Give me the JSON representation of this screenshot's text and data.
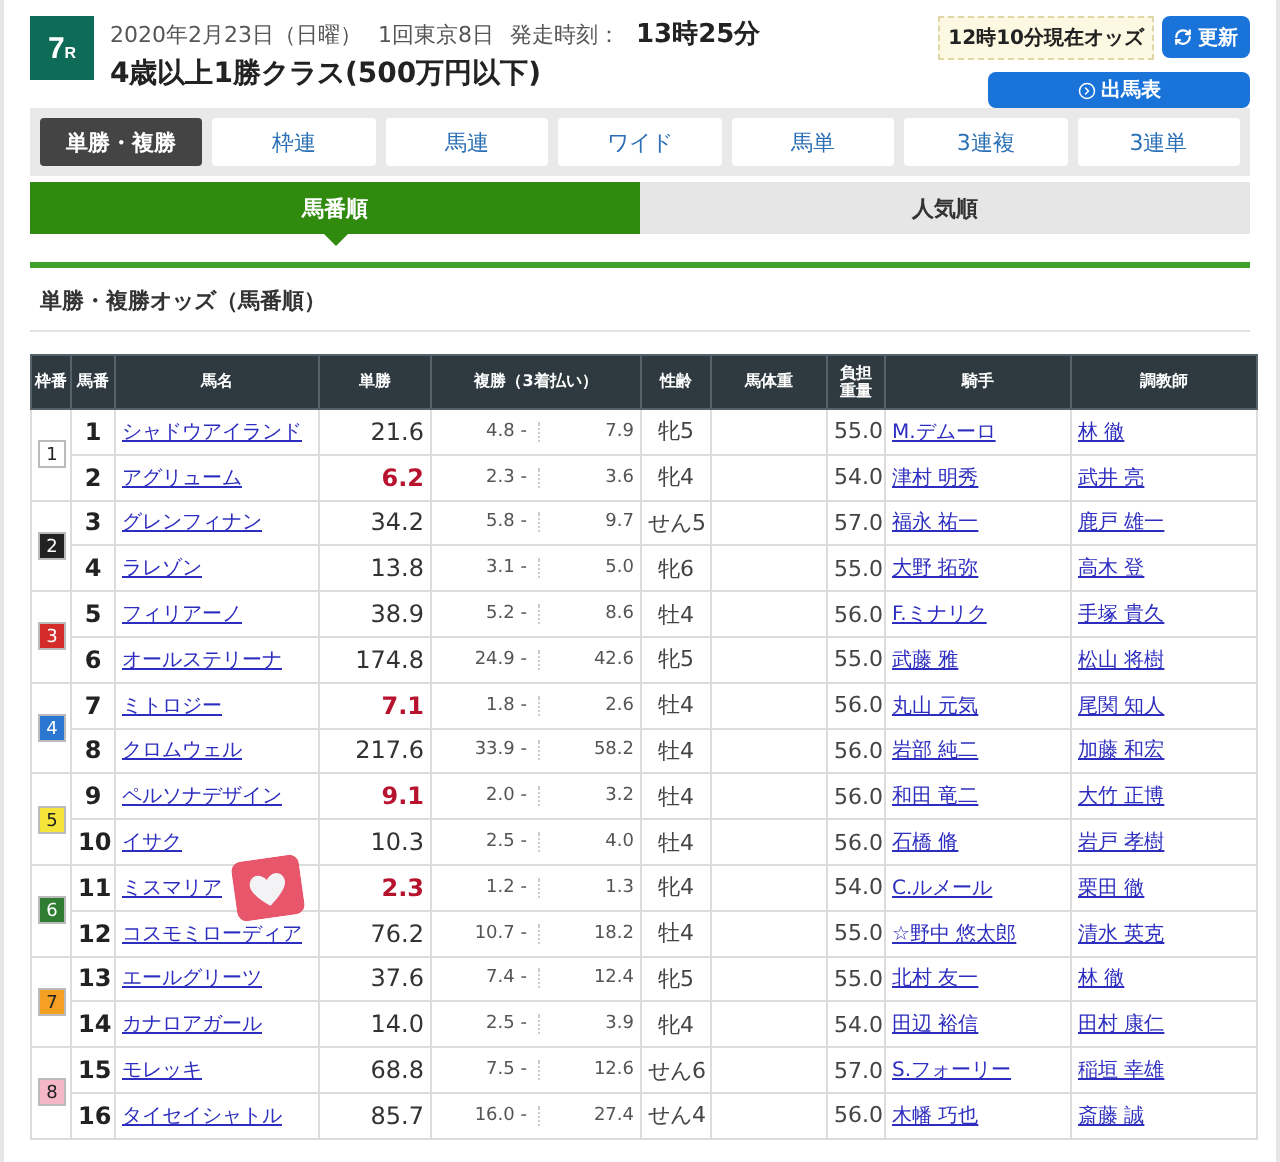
{
  "race": {
    "number": "7",
    "suffix": "R",
    "date": "2020年2月23日（日曜）",
    "meeting": "1回東京8日",
    "start_label": "発走時刻：",
    "start_time": "13時25分",
    "title": "4歳以上1勝クラス(500万円以下)"
  },
  "odds_time": "12時10分現在オッズ",
  "refresh_button": "更新",
  "entries_button": "出馬表",
  "bet_tabs": [
    {
      "label": "単勝・複勝",
      "selected": true
    },
    {
      "label": "枠連",
      "selected": false
    },
    {
      "label": "馬連",
      "selected": false
    },
    {
      "label": "ワイド",
      "selected": false
    },
    {
      "label": "馬単",
      "selected": false
    },
    {
      "label": "3連複",
      "selected": false
    },
    {
      "label": "3連単",
      "selected": false
    }
  ],
  "sort_tabs": [
    {
      "label": "馬番順",
      "selected": true
    },
    {
      "label": "人気順",
      "selected": false
    }
  ],
  "section_title": "単勝・複勝オッズ（馬番順）",
  "table": {
    "columns": [
      "枠番",
      "馬番",
      "馬名",
      "単勝",
      "複勝（3着払い）",
      "性齢",
      "馬体重",
      "負担重量",
      "騎手",
      "調教師"
    ],
    "frames": [
      {
        "frame": "1",
        "color": "#ffffff",
        "horses": [
          {
            "number": "1",
            "name": "シャドウアイランド",
            "win": "21.6",
            "popular": false,
            "place_low": "4.8",
            "place_sep": "-",
            "place_high": "7.9",
            "sex_age": "牝5",
            "burden": "55.0",
            "jockey": "M.デムーロ",
            "trainer": "林 徹"
          },
          {
            "number": "2",
            "name": "アグリューム",
            "win": "6.2",
            "popular": true,
            "place_low": "2.3",
            "place_sep": "-",
            "place_high": "3.6",
            "sex_age": "牝4",
            "burden": "54.0",
            "jockey": "津村 明秀",
            "trainer": "武井 亮"
          }
        ]
      },
      {
        "frame": "2",
        "color": "#222222",
        "horses": [
          {
            "number": "3",
            "name": "グレンフィナン",
            "win": "34.2",
            "popular": false,
            "place_low": "5.8",
            "place_sep": "-",
            "place_high": "9.7",
            "sex_age": "せん5",
            "burden": "57.0",
            "jockey": "福永 祐一",
            "trainer": "鹿戸 雄一"
          },
          {
            "number": "4",
            "name": "ラレゾン",
            "win": "13.8",
            "popular": false,
            "place_low": "3.1",
            "place_sep": "-",
            "place_high": "5.0",
            "sex_age": "牝6",
            "burden": "55.0",
            "jockey": "大野 拓弥",
            "trainer": "高木 登"
          }
        ]
      },
      {
        "frame": "3",
        "color": "#d42b2b",
        "horses": [
          {
            "number": "5",
            "name": "フィリアーノ",
            "win": "38.9",
            "popular": false,
            "place_low": "5.2",
            "place_sep": "-",
            "place_high": "8.6",
            "sex_age": "牡4",
            "burden": "56.0",
            "jockey": "F.ミナリク",
            "trainer": "手塚 貴久"
          },
          {
            "number": "6",
            "name": "オールステリーナ",
            "win": "174.8",
            "popular": false,
            "place_low": "24.9",
            "place_sep": "-",
            "place_high": "42.6",
            "sex_age": "牝5",
            "burden": "55.0",
            "jockey": "武藤 雅",
            "trainer": "松山 将樹"
          }
        ]
      },
      {
        "frame": "4",
        "color": "#2b76d1",
        "horses": [
          {
            "number": "7",
            "name": "ミトロジー",
            "win": "7.1",
            "popular": true,
            "place_low": "1.8",
            "place_sep": "-",
            "place_high": "2.6",
            "sex_age": "牡4",
            "burden": "56.0",
            "jockey": "丸山 元気",
            "trainer": "尾関 知人"
          },
          {
            "number": "8",
            "name": "クロムウェル",
            "win": "217.6",
            "popular": false,
            "place_low": "33.9",
            "place_sep": "-",
            "place_high": "58.2",
            "sex_age": "牡4",
            "burden": "56.0",
            "jockey": "岩部 純二",
            "trainer": "加藤 和宏"
          }
        ]
      },
      {
        "frame": "5",
        "color": "#f5e53a",
        "horses": [
          {
            "number": "9",
            "name": "ペルソナデザイン",
            "win": "9.1",
            "popular": true,
            "place_low": "2.0",
            "place_sep": "-",
            "place_high": "3.2",
            "sex_age": "牡4",
            "burden": "56.0",
            "jockey": "和田 竜二",
            "trainer": "大竹 正博"
          },
          {
            "number": "10",
            "name": "イサク",
            "win": "10.3",
            "popular": false,
            "place_low": "2.5",
            "place_sep": "-",
            "place_high": "4.0",
            "sex_age": "牡4",
            "burden": "56.0",
            "jockey": "石橋 脩",
            "trainer": "岩戸 孝樹"
          }
        ]
      },
      {
        "frame": "6",
        "color": "#2e7d32",
        "horses": [
          {
            "number": "11",
            "name": "ミスマリア",
            "win": "2.3",
            "popular": true,
            "place_low": "1.2",
            "place_sep": "-",
            "place_high": "1.3",
            "sex_age": "牝4",
            "burden": "54.0",
            "jockey": "C.ルメール",
            "trainer": "栗田 徹"
          },
          {
            "number": "12",
            "name": "コスモミローディア",
            "win": "76.2",
            "popular": false,
            "place_low": "10.7",
            "place_sep": "-",
            "place_high": "18.2",
            "sex_age": "牡4",
            "burden": "55.0",
            "jockey": "☆野中 悠太郎",
            "trainer": "清水 英克"
          }
        ]
      },
      {
        "frame": "7",
        "color": "#f5a023",
        "horses": [
          {
            "number": "13",
            "name": "エールグリーツ",
            "win": "37.6",
            "popular": false,
            "place_low": "7.4",
            "place_sep": "-",
            "place_high": "12.4",
            "sex_age": "牝5",
            "burden": "55.0",
            "jockey": "北村 友一",
            "trainer": "林 徹"
          },
          {
            "number": "14",
            "name": "カナロアガール",
            "win": "14.0",
            "popular": false,
            "place_low": "2.5",
            "place_sep": "-",
            "place_high": "3.9",
            "sex_age": "牝4",
            "burden": "54.0",
            "jockey": "田辺 裕信",
            "trainer": "田村 康仁"
          }
        ]
      },
      {
        "frame": "8",
        "color": "#f4b6c8",
        "horses": [
          {
            "number": "15",
            "name": "モレッキ",
            "win": "68.8",
            "popular": false,
            "place_low": "7.5",
            "place_sep": "-",
            "place_high": "12.6",
            "sex_age": "せん6",
            "burden": "57.0",
            "jockey": "S.フォーリー",
            "trainer": "稲垣 幸雄"
          },
          {
            "number": "16",
            "name": "タイセイシャトル",
            "win": "85.7",
            "popular": false,
            "place_low": "16.0",
            "place_sep": "-",
            "place_high": "27.4",
            "sex_age": "せん4",
            "burden": "56.0",
            "jockey": "木幡 巧也",
            "trainer": "斎藤 誠"
          }
        ]
      }
    ]
  }
}
